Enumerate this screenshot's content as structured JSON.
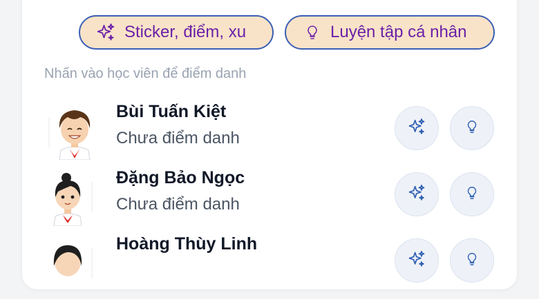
{
  "toolbar": {
    "sticker_label": "Sticker, điểm, xu",
    "practice_label": "Luyện tập cá nhân"
  },
  "hint": "Nhấn vào học viên để điểm danh",
  "students": [
    {
      "name": "Bùi Tuấn Kiệt",
      "status": "Chưa điểm danh"
    },
    {
      "name": "Đặng Bảo Ngọc",
      "status": "Chưa điểm danh"
    },
    {
      "name": "Hoàng Thùy Linh",
      "status": ""
    }
  ],
  "icons": {
    "sticker": "sparkles-icon",
    "practice": "lightbulb-icon"
  },
  "colors": {
    "accent_purple": "#6b21a8",
    "pill_bg": "#f9e3c8",
    "pill_border": "#3b5fb5",
    "round_btn_bg": "#eef2f8"
  }
}
